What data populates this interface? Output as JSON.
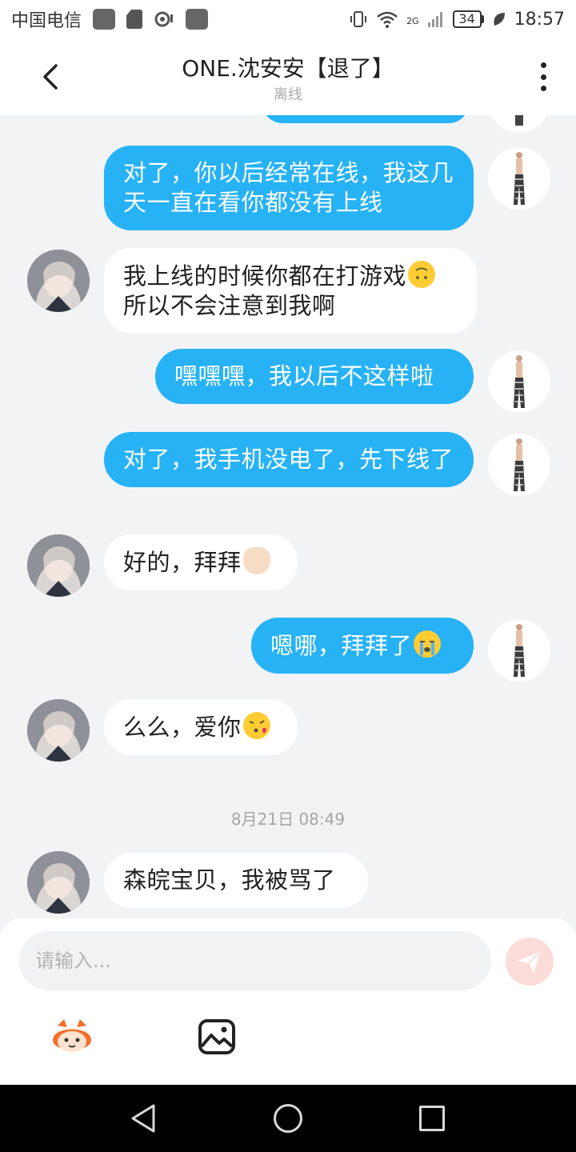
{
  "status_bar": {
    "carrier": "中国电信",
    "network": "2G",
    "battery": "34",
    "time": "18:57"
  },
  "header": {
    "title": "ONE.沈安安【退了】",
    "status": "离线"
  },
  "messages": [
    {
      "from": "me",
      "text": "对了，你以后经常在线，我这几天一直在看你都没有上线"
    },
    {
      "from": "them",
      "text": "我上线的时候你都在打游戏",
      "emoji": "upside-down-face-emoji",
      "text2": "所以不会注意到我啊"
    },
    {
      "from": "me",
      "text": "嘿嘿嘿，我以后不这样啦"
    },
    {
      "from": "me",
      "text": "对了，我手机没电了，先下线了"
    },
    {
      "from": "them",
      "text": "好的，拜拜",
      "emoji": "waving-hand-emoji"
    },
    {
      "from": "me",
      "text": "嗯哪，拜拜了",
      "emoji": "crying-face-emoji"
    },
    {
      "from": "them",
      "text": "么么，爱你",
      "emoji": "kissing-heart-emoji"
    },
    {
      "from": "them",
      "text": "森皖宝贝，我被骂了"
    }
  ],
  "timestamp": "8月21日 08:49",
  "input": {
    "placeholder": "请输入..."
  },
  "colors": {
    "my_bubble": "#27b2f6",
    "their_bubble": "#ffffff",
    "background": "#f2f3f5",
    "send_button": "#fbdcd8"
  }
}
